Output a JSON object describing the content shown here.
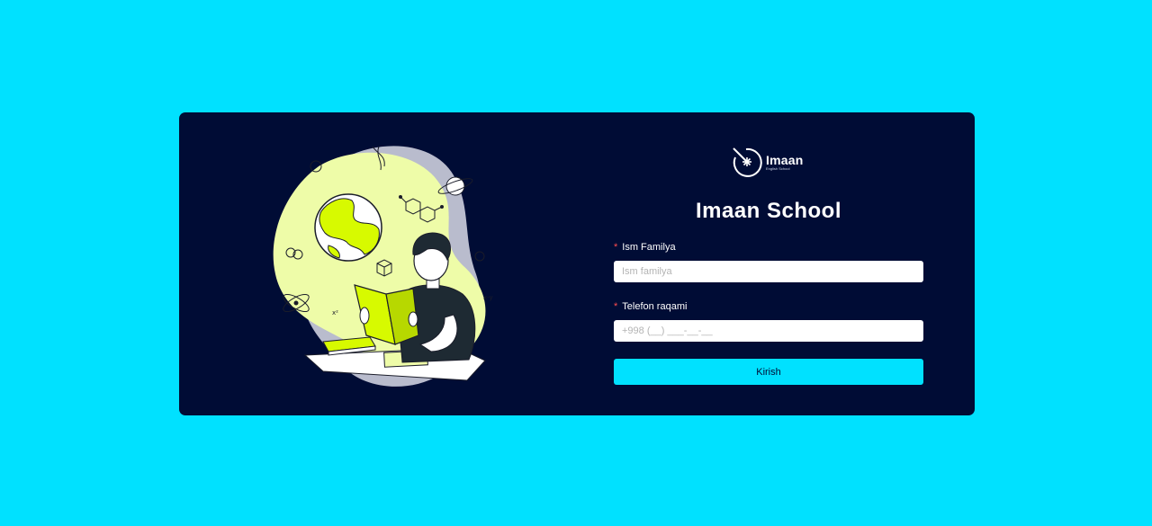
{
  "logo": {
    "name": "Imaan",
    "subtitle": "English School"
  },
  "form": {
    "title": "Imaan School",
    "required_marker": "*",
    "name_field": {
      "label": "Ism Familya",
      "placeholder": "Ism familya",
      "value": ""
    },
    "phone_field": {
      "label": "Telefon raqami",
      "placeholder": "+998 (__) ___-__-__",
      "value": ""
    },
    "submit_label": "Kirish"
  },
  "colors": {
    "page_background": "#00e1ff",
    "card_background": "#000c35",
    "accent": "#00e1ff",
    "illustration_yellow": "#eefca8",
    "illustration_lime": "#d7fa00",
    "required": "#ff4d4f"
  },
  "illustration": {
    "icon": "student-reading-illustration"
  }
}
